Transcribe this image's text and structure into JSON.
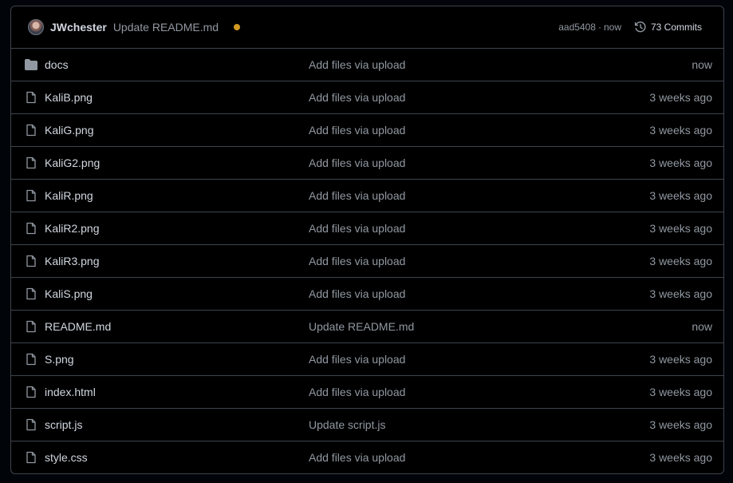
{
  "header": {
    "author": "JWchester",
    "commit_message": "Update README.md",
    "sha": "aad5408",
    "separator": "·",
    "time": "now",
    "commits_label": "73 Commits",
    "status_color": "#d29922"
  },
  "files": [
    {
      "name": "docs",
      "type": "folder",
      "message": "Add files via upload",
      "age": "now"
    },
    {
      "name": "KaliB.png",
      "type": "file",
      "message": "Add files via upload",
      "age": "3 weeks ago"
    },
    {
      "name": "KaliG.png",
      "type": "file",
      "message": "Add files via upload",
      "age": "3 weeks ago"
    },
    {
      "name": "KaliG2.png",
      "type": "file",
      "message": "Add files via upload",
      "age": "3 weeks ago"
    },
    {
      "name": "KaliR.png",
      "type": "file",
      "message": "Add files via upload",
      "age": "3 weeks ago"
    },
    {
      "name": "KaliR2.png",
      "type": "file",
      "message": "Add files via upload",
      "age": "3 weeks ago"
    },
    {
      "name": "KaliR3.png",
      "type": "file",
      "message": "Add files via upload",
      "age": "3 weeks ago"
    },
    {
      "name": "KaliS.png",
      "type": "file",
      "message": "Add files via upload",
      "age": "3 weeks ago"
    },
    {
      "name": "README.md",
      "type": "file",
      "message": "Update README.md",
      "age": "now"
    },
    {
      "name": "S.png",
      "type": "file",
      "message": "Add files via upload",
      "age": "3 weeks ago"
    },
    {
      "name": "index.html",
      "type": "file",
      "message": "Add files via upload",
      "age": "3 weeks ago"
    },
    {
      "name": "script.js",
      "type": "file",
      "message": "Update script.js",
      "age": "3 weeks ago"
    },
    {
      "name": "style.css",
      "type": "file",
      "message": "Add files via upload",
      "age": "3 weeks ago"
    }
  ]
}
